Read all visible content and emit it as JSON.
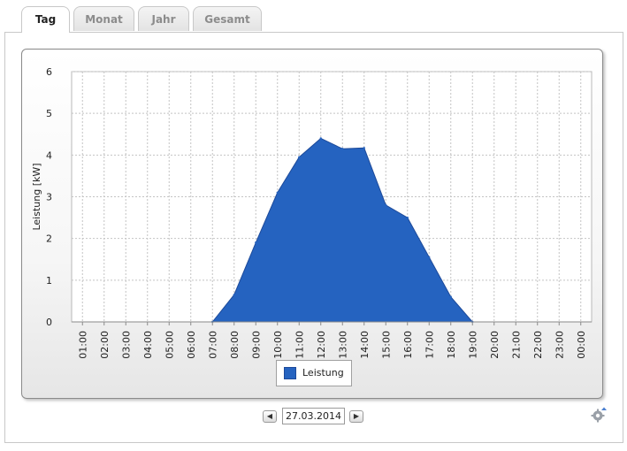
{
  "tabs": [
    {
      "label": "Tag",
      "active": true
    },
    {
      "label": "Monat",
      "active": false
    },
    {
      "label": "Jahr",
      "active": false
    },
    {
      "label": "Gesamt",
      "active": false
    }
  ],
  "navigation": {
    "prev_symbol": "◀",
    "date_value": "27.03.2014",
    "next_symbol": "▶"
  },
  "icons": {
    "settings": "gear-icon",
    "prev": "arrow-left-icon",
    "next": "arrow-right-icon"
  },
  "colors": {
    "series": "#2563c0",
    "series_border": "#1d4a9a",
    "grid": "#c4c4c4"
  },
  "chart_data": {
    "type": "area",
    "ylabel": "Leistung [kW]",
    "xlabel": "",
    "ylim": [
      0,
      6
    ],
    "yticks": [
      "0",
      "1",
      "2",
      "3",
      "4",
      "5",
      "6"
    ],
    "categories": [
      "01:00",
      "02:00",
      "03:00",
      "04:00",
      "05:00",
      "06:00",
      "07:00",
      "08:00",
      "09:00",
      "10:00",
      "11:00",
      "12:00",
      "13:00",
      "14:00",
      "15:00",
      "16:00",
      "17:00",
      "18:00",
      "19:00",
      "20:00",
      "21:00",
      "22:00",
      "23:00",
      "00:00"
    ],
    "series": [
      {
        "name": "Leistung",
        "points": [
          {
            "x": "07:00",
            "y": 0.0
          },
          {
            "x": "08:00",
            "y": 0.65
          },
          {
            "x": "09:00",
            "y": 1.9
          },
          {
            "x": "10:00",
            "y": 3.1
          },
          {
            "x": "11:00",
            "y": 3.95
          },
          {
            "x": "12:00",
            "y": 4.4
          },
          {
            "x": "13:00",
            "y": 4.15
          },
          {
            "x": "14:00",
            "y": 4.17
          },
          {
            "x": "15:00",
            "y": 2.8
          },
          {
            "x": "16:00",
            "y": 2.5
          },
          {
            "x": "17:00",
            "y": 1.55
          },
          {
            "x": "18:00",
            "y": 0.6
          },
          {
            "x": "19:00",
            "y": 0.0
          }
        ]
      }
    ],
    "grid": true,
    "legend": "bottom-center"
  }
}
